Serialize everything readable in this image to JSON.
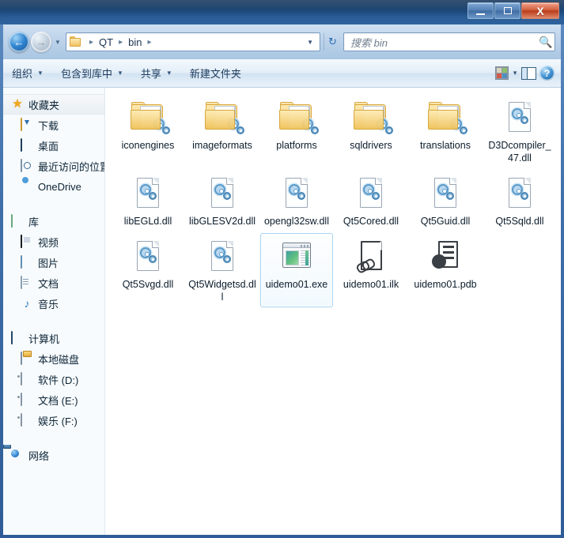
{
  "window": {
    "title": "",
    "controls": {
      "minimize": "minimize-button",
      "maximize": "maximize-button",
      "close": "X"
    }
  },
  "navigation": {
    "back_tooltip": "后退",
    "forward_tooltip": "前进",
    "breadcrumb": [
      "QT",
      "bin"
    ],
    "breadcrumb_separator": "▸",
    "refresh_label": "↻"
  },
  "search": {
    "placeholder": "搜索 bin",
    "value": "",
    "icon": "search-icon"
  },
  "toolbar": {
    "items": [
      {
        "label": "组织",
        "has_caret": true
      },
      {
        "label": "包含到库中",
        "has_caret": true
      },
      {
        "label": "共享",
        "has_caret": true
      },
      {
        "label": "新建文件夹",
        "has_caret": false
      }
    ],
    "view_caret": "▼",
    "help_label": "?"
  },
  "sidebar": {
    "groups": [
      {
        "header": {
          "label": "收藏夹",
          "icon": "star-icon",
          "selected": true
        },
        "items": [
          {
            "label": "下载",
            "icon": "downloads-icon"
          },
          {
            "label": "桌面",
            "icon": "desktop-icon"
          },
          {
            "label": "最近访问的位置",
            "icon": "recent-places-icon"
          },
          {
            "label": "OneDrive",
            "icon": "cloud-icon"
          }
        ]
      },
      {
        "header": {
          "label": "库",
          "icon": "library-icon",
          "selected": false
        },
        "items": [
          {
            "label": "视频",
            "icon": "video-icon"
          },
          {
            "label": "图片",
            "icon": "pictures-icon"
          },
          {
            "label": "文档",
            "icon": "documents-icon"
          },
          {
            "label": "音乐",
            "icon": "music-icon"
          }
        ]
      },
      {
        "header": {
          "label": "计算机",
          "icon": "computer-icon",
          "selected": false
        },
        "items": [
          {
            "label": "本地磁盘",
            "icon": "harddisk-icon"
          },
          {
            "label": "软件 (D:)",
            "icon": "drive-icon"
          },
          {
            "label": "文档 (E:)",
            "icon": "drive-icon"
          },
          {
            "label": "娱乐 (F:)",
            "icon": "drive-icon"
          }
        ]
      },
      {
        "header": {
          "label": "网络",
          "icon": "network-icon",
          "selected": false
        },
        "items": []
      }
    ]
  },
  "files": [
    {
      "name": "iconengines",
      "type": "folder",
      "selected": false
    },
    {
      "name": "imageformats",
      "type": "folder",
      "selected": false
    },
    {
      "name": "platforms",
      "type": "folder",
      "selected": false
    },
    {
      "name": "sqldrivers",
      "type": "folder",
      "selected": false
    },
    {
      "name": "translations",
      "type": "folder",
      "selected": false
    },
    {
      "name": "D3Dcompiler_47.dll",
      "type": "dll",
      "selected": false
    },
    {
      "name": "libEGLd.dll",
      "type": "dll",
      "selected": false
    },
    {
      "name": "libGLESV2d.dll",
      "type": "dll",
      "selected": false
    },
    {
      "name": "opengl32sw.dll",
      "type": "dll",
      "selected": false
    },
    {
      "name": "Qt5Cored.dll",
      "type": "dll",
      "selected": false
    },
    {
      "name": "Qt5Guid.dll",
      "type": "dll",
      "selected": false
    },
    {
      "name": "Qt5Sqld.dll",
      "type": "dll",
      "selected": false
    },
    {
      "name": "Qt5Svgd.dll",
      "type": "dll",
      "selected": false
    },
    {
      "name": "Qt5Widgetsd.dll",
      "type": "dll",
      "selected": false
    },
    {
      "name": "uidemo01.exe",
      "type": "exe",
      "selected": true
    },
    {
      "name": "uidemo01.ilk",
      "type": "ilk",
      "selected": false
    },
    {
      "name": "uidemo01.pdb",
      "type": "pdb",
      "selected": false
    }
  ],
  "colors": {
    "titlebar": "#17406e",
    "accent": "#2b6cb0",
    "selection_border": "#a8d4f0",
    "folder": "#f4cc71",
    "close_button": "#b83c1c"
  }
}
